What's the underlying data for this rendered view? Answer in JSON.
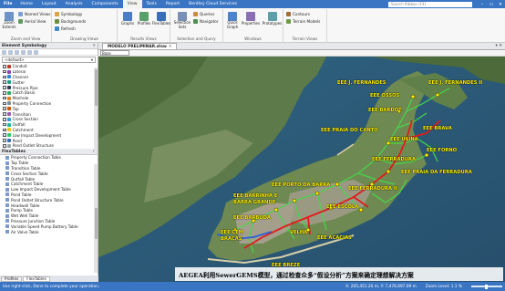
{
  "titlebar": {
    "file_button": "File",
    "menu": [
      "Home",
      "Layout",
      "Analysis",
      "Components",
      "View",
      "Tools",
      "Report",
      "Bentley Cloud Services"
    ],
    "active_menu": "View",
    "search_placeholder": "Search Ribbon (F4)",
    "min": "–",
    "max": "▭",
    "close": "✕"
  },
  "ribbon": {
    "zoom": {
      "extents_label": "Zoom Extents",
      "named_views": "Named Views",
      "aerial_view": "Aerial View",
      "group_label": "Zoom and View"
    },
    "drawing": {
      "symbology": "Symbology",
      "backgrounds": "Backgrounds",
      "refresh": "Refresh",
      "group_label": "Drawing Views"
    },
    "results": {
      "graphs": "Graphs",
      "profiles": "Profiles",
      "flextables": "FlexTables",
      "group_label": "Results Views"
    },
    "selection": {
      "selection_sets": "Selection Sets",
      "queries": "Queries",
      "navigator": "Navigator",
      "group_label": "Selection and Query"
    },
    "quick": {
      "quick_graph": "Quick Graph",
      "properties": "Properties",
      "prototypes": "Prototypes",
      "group_label": "Windows"
    },
    "terrain": {
      "contours": "Contours",
      "terrain_models": "Terrain Models",
      "group_label": "Terrain Views"
    }
  },
  "element_symbology": {
    "title": "Element Symbology",
    "combo_value": "<default>",
    "items": [
      {
        "label": "Conduit",
        "color": "#c0392b"
      },
      {
        "label": "Lateral",
        "color": "#8e44ad"
      },
      {
        "label": "Channel",
        "color": "#2e86de"
      },
      {
        "label": "Gutter",
        "color": "#16a085"
      },
      {
        "label": "Pressure Pipe",
        "color": "#2c3e50"
      },
      {
        "label": "Catch Basin",
        "color": "#27ae60"
      },
      {
        "label": "Manhole",
        "color": "#e67e22"
      },
      {
        "label": "Property Connection",
        "color": "#7f8c8d"
      },
      {
        "label": "Tap",
        "color": "#d35400"
      },
      {
        "label": "Transition",
        "color": "#9b59b6"
      },
      {
        "label": "Cross Section",
        "color": "#3498db"
      },
      {
        "label": "Outfall",
        "color": "#1abc9c"
      },
      {
        "label": "Catchment",
        "color": "#f1c40f"
      },
      {
        "label": "Low Impact Development",
        "color": "#2ecc71"
      },
      {
        "label": "Pond",
        "color": "#3b6fb6"
      },
      {
        "label": "Pond Outlet Structure",
        "color": "#95a5a6"
      }
    ]
  },
  "flextables": {
    "title": "FlexTables",
    "items": [
      "Property Connection Table",
      "Tap Table",
      "Transition Table",
      "Cross Section Table",
      "Outfall Table",
      "Catchment Table",
      "Low Impact Development Table",
      "Pond Table",
      "Pond Outlet Structure Table",
      "Headwall Table",
      "Pump Table",
      "Wet Well Table",
      "Pressure Junction Table",
      "Variable Speed Pump Battery Table",
      "Air Valve Table"
    ]
  },
  "bottom_tabs": [
    "Profiles",
    "FlexTables"
  ],
  "active_bottom_tab": "FlexTables",
  "document": {
    "tab_title": "MODELO PRELIMINAR.stsw",
    "view_combo": "Base"
  },
  "map_labels": [
    "EEE J. FERNANDES",
    "EEE J. FERNANDES II",
    "EEE OSSOS",
    "EEE BARDOT",
    "EEE PRAIA DO CANTO",
    "EEE BRAVA",
    "EEE USINA",
    "EEE FORNO",
    "EEE FERRADURA",
    "EEE PRAIA DA FERRADURA",
    "EEE PORTO DA BARRA",
    "EEE FERRADURA II",
    "EEE BARRINHA E",
    "BARRA GRANDE",
    "EEE BARBUDA",
    "EEE ESCOLA",
    "EEE CEM",
    "BRAÇAS",
    "VELHA",
    "EEE ACÁCIAS",
    "EEE BREZE"
  ],
  "banner_text": "AEGEA利用SewerGEMS模型，通过检查众多“假设分析”方案来确定理想解决方案",
  "status": {
    "hint": "Use right-click, Done to complete your operation.",
    "coords": "X: 205,451.20 m, Y: 7,476,697.09 m",
    "zoom": "Zoom Level: 1.1 %"
  },
  "colors": {
    "accent": "#3a75c4",
    "label_yellow": "#ffef00",
    "pipe_red": "#e31b1b",
    "pipe_green": "#47d64a"
  }
}
